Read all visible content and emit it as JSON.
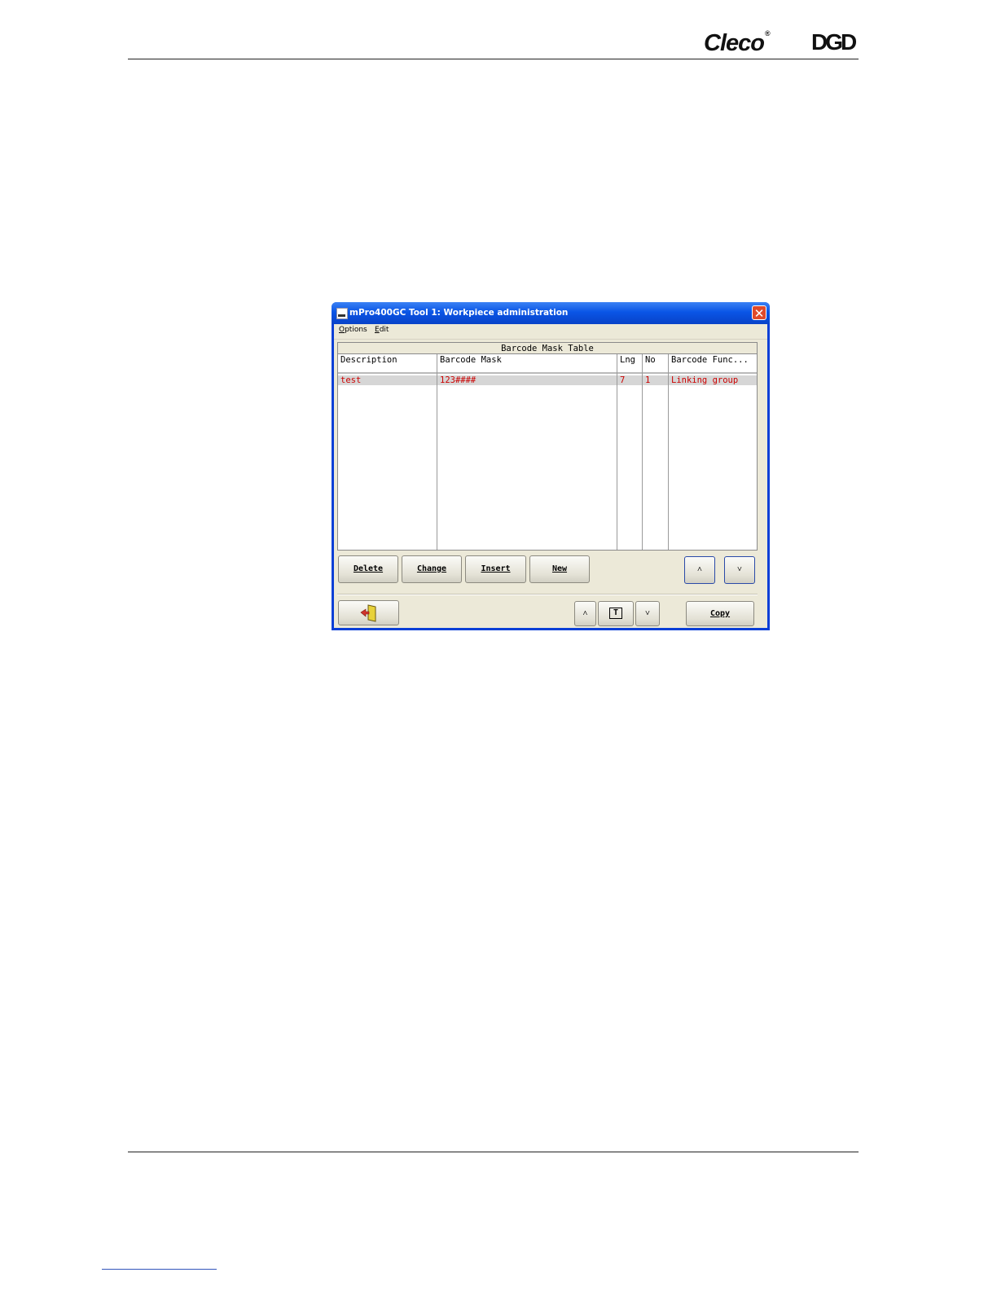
{
  "header": {
    "logo_cleco": "Cleco",
    "logo_cleco_mark": "®",
    "logo_dgd": "DGD"
  },
  "window": {
    "title": "mPro400GC Tool 1:  Workpiece administration",
    "close_glyph": "✕",
    "menu": [
      {
        "accel": "O",
        "rest": "ptions"
      },
      {
        "accel": "E",
        "rest": "dit"
      }
    ],
    "table": {
      "title": "Barcode Mask Table",
      "columns": [
        "Description",
        "Barcode Mask",
        "Lng",
        "No",
        "Barcode Func..."
      ],
      "rows": [
        {
          "description": "test",
          "mask": "123####",
          "lng": "7",
          "no": "1",
          "func": "Linking group"
        }
      ]
    },
    "buttons": {
      "delete": "Delete",
      "change": "Change",
      "insert": "Insert",
      "new": "New",
      "up": "˄",
      "down": "˅",
      "copy": "Copy",
      "text_icon": "T"
    },
    "colors": {
      "title_bar": "#0a55e6",
      "selected_row_text": "#cc0000",
      "dialog_bg": "#ece9d8"
    }
  }
}
